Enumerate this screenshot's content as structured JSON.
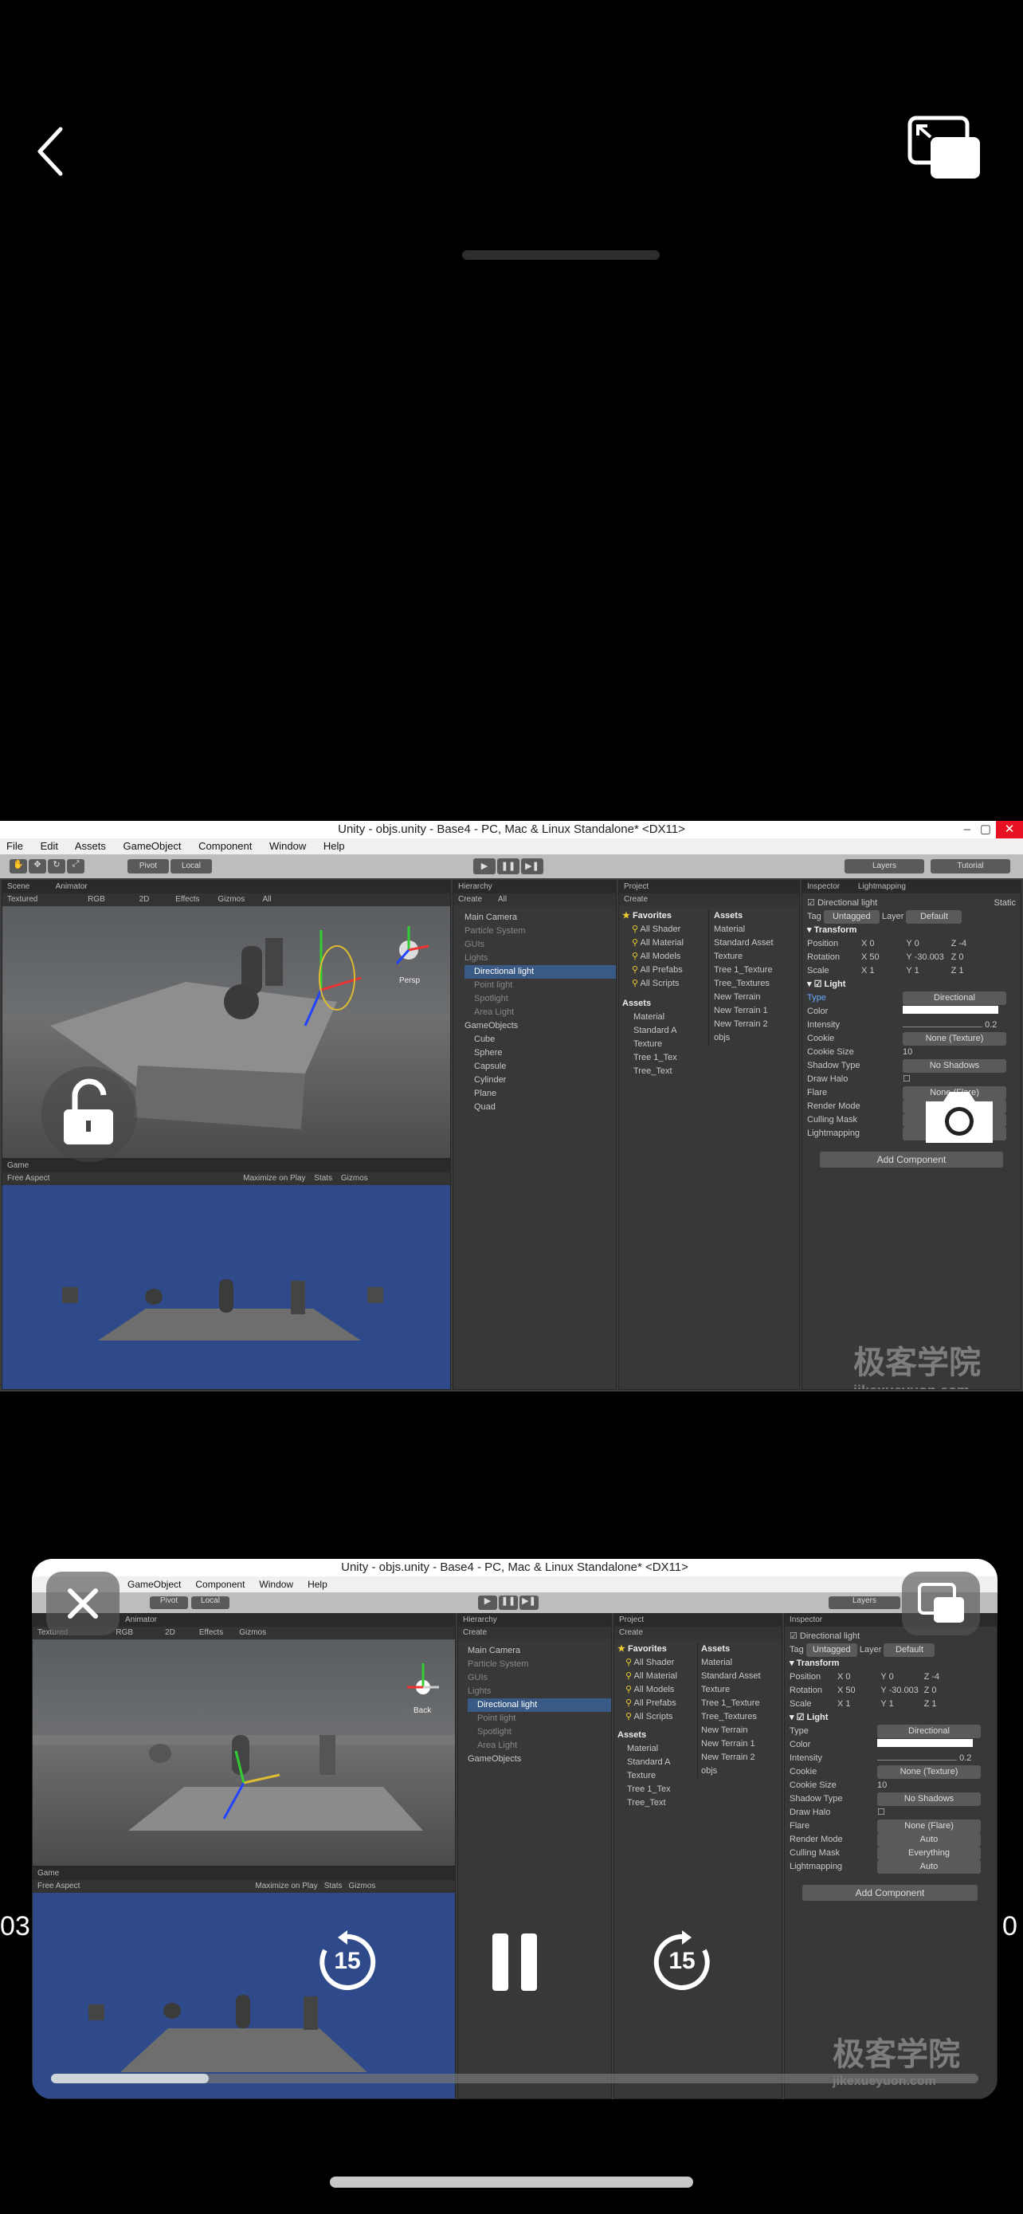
{
  "player": {
    "time_left_partial": "03",
    "time_right_partial": "0",
    "skip_back_seconds": "15",
    "skip_forward_seconds": "15",
    "progress": 0.17
  },
  "unity": {
    "window_title": "Unity - objs.unity - Base4 - PC, Mac & Linux Standalone* <DX11>",
    "menu": [
      "File",
      "Edit",
      "Assets",
      "GameObject",
      "Component",
      "Window",
      "Help"
    ],
    "menu_mini": [
      "GameObject",
      "Component",
      "Window",
      "Help"
    ],
    "toolbar": {
      "pivot": "Pivot",
      "local": "Local",
      "layers": "Layers",
      "layout": "Tutorial"
    },
    "scene_tabs": {
      "scene": "Scene",
      "animator": "Animator"
    },
    "scene_bar": {
      "shading": "Textured",
      "color": "RGB",
      "mode2d": "2D",
      "effects": "Effects",
      "gizmos": "Gizmos",
      "search": "All"
    },
    "persp_label": "Persp",
    "back_label": "Back",
    "game_tab": "Game",
    "game_bar": {
      "aspect": "Free Aspect",
      "maximize": "Maximize on Play",
      "stats": "Stats",
      "gizmos": "Gizmos"
    },
    "hierarchy": {
      "tab": "Hierarchy",
      "create": "Create",
      "search": "All",
      "items": [
        "Main Camera",
        "Particle System",
        "GUIs",
        "Lights",
        "Directional light",
        "Point light",
        "Spotlight",
        "Area Light",
        "GameObjects",
        "Cube",
        "Sphere",
        "Capsule",
        "Cylinder",
        "Plane",
        "Quad"
      ]
    },
    "project": {
      "tab": "Project",
      "create": "Create",
      "favorites_label": "Favorites",
      "favorites": [
        "All Shader",
        "All Material",
        "All Models",
        "All Prefabs",
        "All Scripts"
      ],
      "assets_label": "Assets",
      "assets_tree": [
        "Material",
        "Standard A",
        "Texture",
        "Tree 1_Tex",
        "Tree_Text"
      ],
      "assets_header": "Assets",
      "assets_items": [
        "Material",
        "Standard Asset",
        "Texture",
        "Tree 1_Texture",
        "Tree_Textures",
        "New Terrain",
        "New Terrain 1",
        "New Terrain 2",
        "objs"
      ]
    },
    "inspector": {
      "tab": "Inspector",
      "tab2": "Lightmapping",
      "object_name": "Directional light",
      "static": "Static",
      "tag_label": "Tag",
      "tag": "Untagged",
      "layer_label": "Layer",
      "layer": "Default",
      "transform": "Transform",
      "position_label": "Position",
      "position": {
        "x": "0",
        "y": "0",
        "z": "-4"
      },
      "rotation_label": "Rotation",
      "rotation": {
        "x": "50",
        "y": "-30.003",
        "z": "0"
      },
      "scale_label": "Scale",
      "scale": {
        "x": "1",
        "y": "1",
        "z": "1"
      },
      "light": "Light",
      "type_label": "Type",
      "type": "Directional",
      "color_label": "Color",
      "intensity_label": "Intensity",
      "intensity": "0.2",
      "cookie_label": "Cookie",
      "cookie": "None (Texture)",
      "cookie_size_label": "Cookie Size",
      "cookie_size": "10",
      "shadow_type_label": "Shadow Type",
      "shadow_type": "No Shadows",
      "draw_halo_label": "Draw Halo",
      "flare_label": "Flare",
      "flare": "None (Flare)",
      "render_mode_label": "Render Mode",
      "render_mode": "Auto",
      "culling_mask_label": "Culling Mask",
      "culling_mask": "Everything",
      "lightmapping_label": "Lightmapping",
      "lightmapping": "Auto",
      "add_component": "Add Component"
    },
    "watermark": {
      "cn": "极客学院",
      "en": "jikexueyuon.com"
    }
  }
}
